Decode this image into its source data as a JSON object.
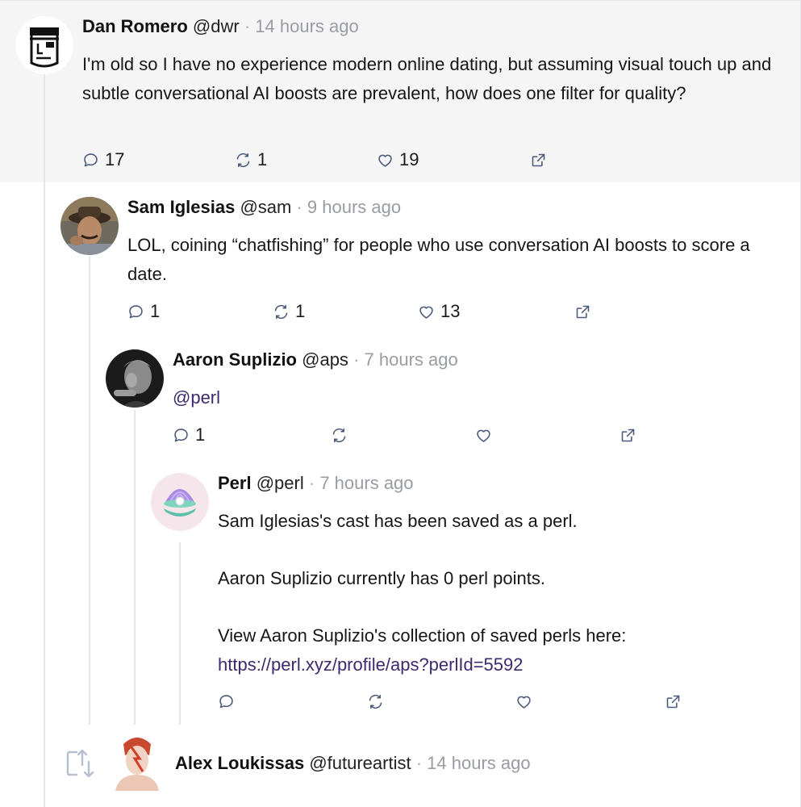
{
  "thread": {
    "root": {
      "name": "Dan Romero",
      "handle": "@dwr",
      "separator": "·",
      "time": "14 hours ago",
      "text": "I'm old so I have no experience modern online dating, but assuming visual touch up and subtle conversational AI boosts are prevalent, how does one filter for quality?",
      "replies": "17",
      "recasts": "1",
      "likes": "19"
    },
    "reply1": {
      "name": "Sam Iglesias",
      "handle": "@sam",
      "separator": "·",
      "time": "9 hours ago",
      "text": "LOL, coining “chatfishing” for people who use conversation AI boosts to score a date.",
      "replies": "1",
      "recasts": "1",
      "likes": "13"
    },
    "reply2": {
      "name": "Aaron Suplizio",
      "handle": "@aps",
      "separator": "·",
      "time": "7 hours ago",
      "mention": "@perl",
      "replies": "1"
    },
    "reply3": {
      "name": "Perl",
      "handle": "@perl",
      "separator": "·",
      "time": "7 hours ago",
      "line1": "Sam Iglesias's cast has been saved as a perl.",
      "line2": "Aaron Suplizio currently has 0 perl points.",
      "line3": "View Aaron Suplizio's collection of saved perls here:",
      "link": "https://perl.xyz/profile/aps?perlId=5592"
    },
    "reply4": {
      "name": "Alex Loukissas",
      "handle": "@futureartist",
      "separator": "·",
      "time": "14 hours ago"
    }
  },
  "icons": {
    "reply": "speech-bubble-icon",
    "recast": "recast-arrows-icon",
    "like": "heart-icon",
    "share": "external-link-icon",
    "expand": "expand-thread-icon"
  },
  "colors": {
    "link": "#3b2a6e",
    "muted": "#9a9ca3",
    "icon": "#4a5a78",
    "thread_line": "#e3e6ec",
    "highlight_bg": "#f5f5f6"
  }
}
